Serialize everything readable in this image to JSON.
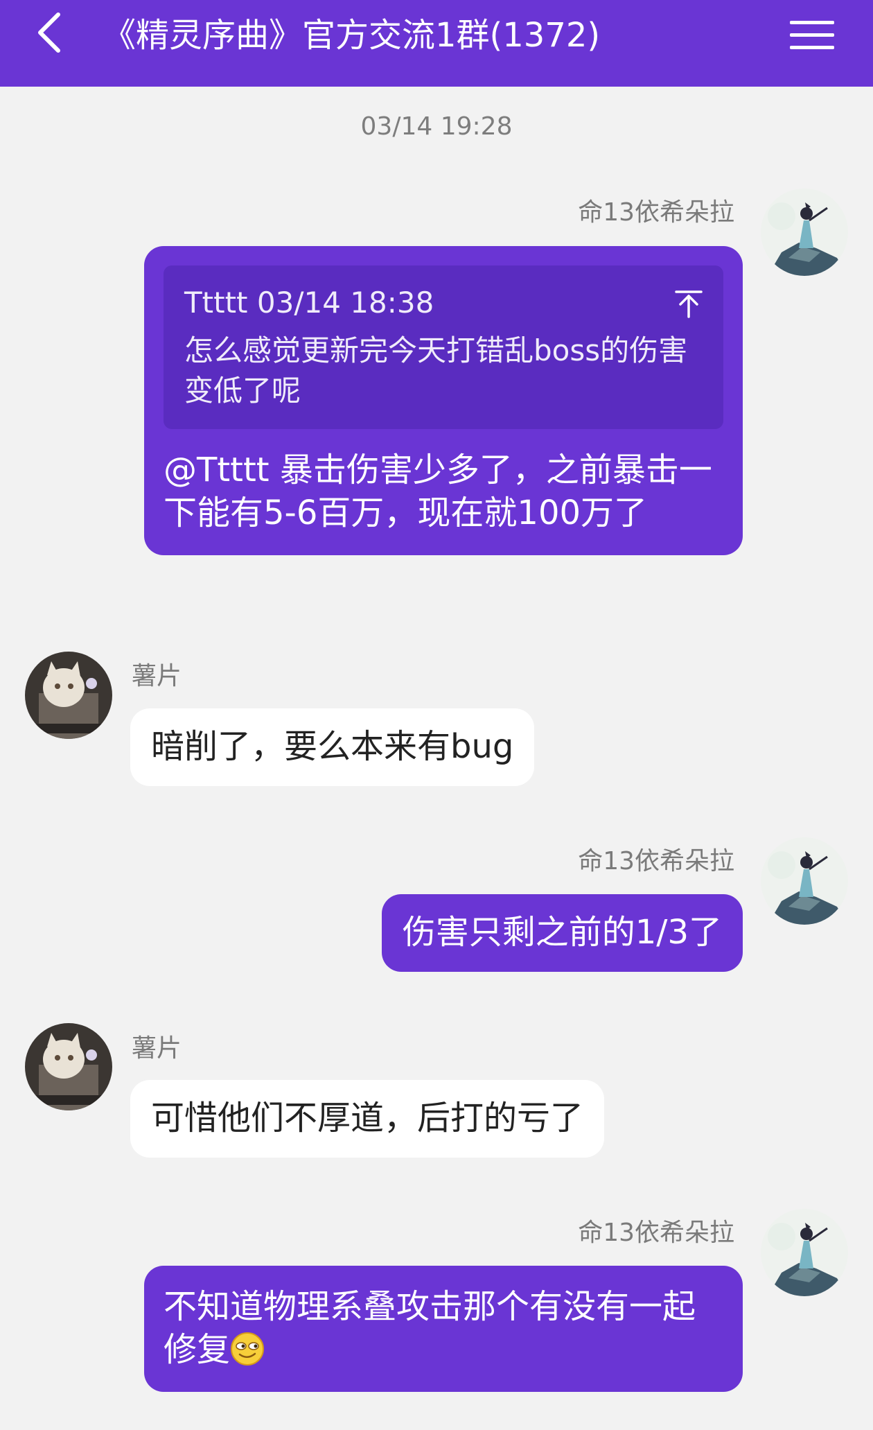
{
  "header": {
    "title": "《精灵序曲》官方交流1群(1372)",
    "back_icon": "chevron-left-icon",
    "menu_icon": "hamburger-menu-icon"
  },
  "timestamp": "03/14 19:28",
  "colors": {
    "brand": "#6a35d4",
    "quote_bg": "#5a2cc0",
    "chat_bg": "#f2f2f2",
    "other_bubble": "#ffffff"
  },
  "messages": [
    {
      "sender": "命13依希朵拉",
      "side": "self",
      "quote": {
        "header": "Ttttt 03/14 18:38",
        "text": "怎么感觉更新完今天打错乱boss的伤害变低了呢"
      },
      "text": "@Ttttt 暴击伤害少多了，之前暴击一下能有5-6百万，现在就100万了"
    },
    {
      "sender": "薯片",
      "side": "other",
      "text": "暗削了，要么本来有bug"
    },
    {
      "sender": "命13依希朵拉",
      "side": "self",
      "text": "伤害只剩之前的1/3了"
    },
    {
      "sender": "薯片",
      "side": "other",
      "text": "可惜他们不厚道，后打的亏了"
    },
    {
      "sender": "命13依希朵拉",
      "side": "self",
      "text": "不知道物理系叠攻击那个有没有一起修复",
      "emoji": "smug-face-emoji"
    }
  ]
}
